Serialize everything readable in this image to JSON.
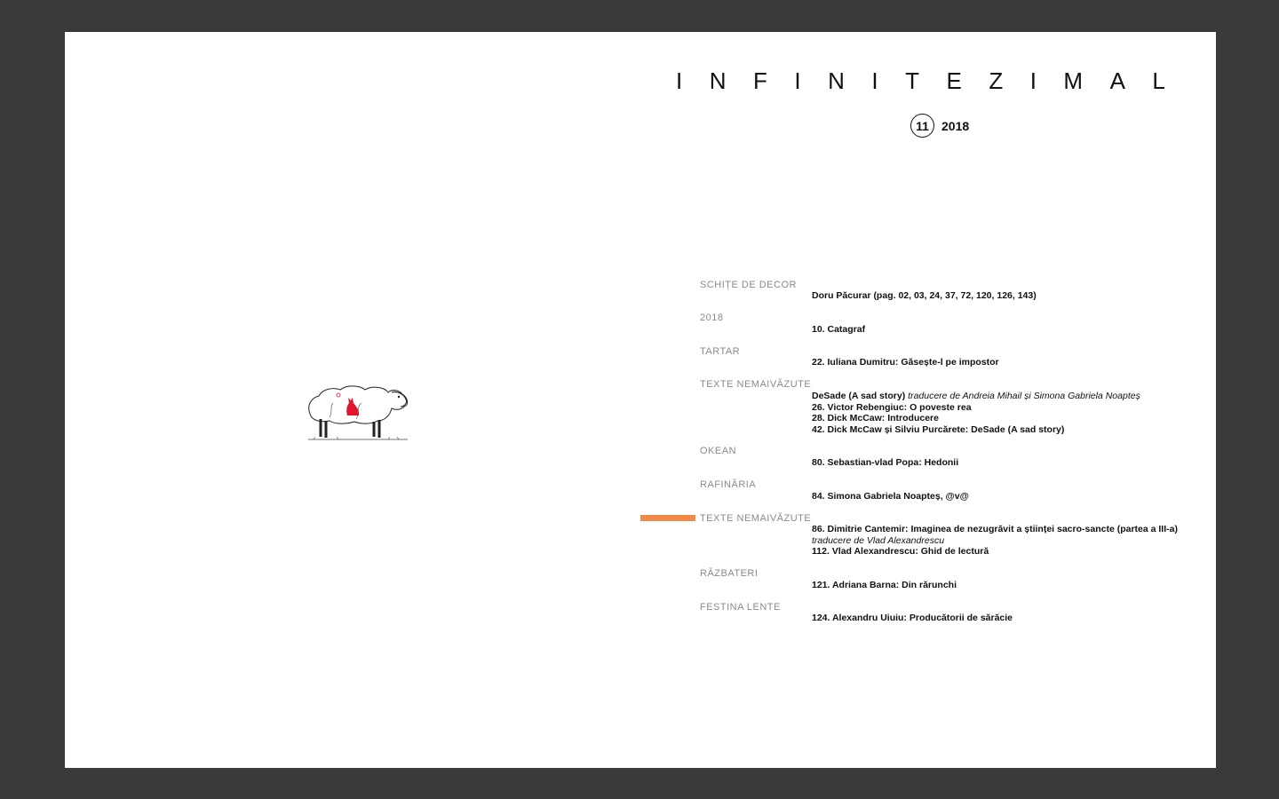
{
  "masthead": {
    "title": "INFINITEZIMAL",
    "issue_number": "11",
    "year": "2018"
  },
  "toc": [
    {
      "section": "SCHIȚE DE DECOR",
      "entries": [
        {
          "text": "Doru Păcurar (pag. 02, 03, 24, 37, 72, 120, 126, 143)"
        }
      ]
    },
    {
      "section": "2018",
      "entries": [
        {
          "text": "10. Catagraf"
        }
      ]
    },
    {
      "section": "TARTAR",
      "entries": [
        {
          "text": "22. Iuliana Dumitru: Găsește-l pe impostor"
        }
      ]
    },
    {
      "section": "TEXTE NEMAIVĂZUTE",
      "entries": [
        {
          "text": "DeSade (A sad story)",
          "italic": "traducere de Andreia Mihail și Simona Gabriela Noapteș"
        },
        {
          "text": "26. Victor Rebengiuc: O poveste rea"
        },
        {
          "text": "28. Dick McCaw: Introducere"
        },
        {
          "text": "42. Dick McCaw și Silviu Purcărete: DeSade (A sad story)"
        }
      ]
    },
    {
      "section": "OKEAN",
      "entries": [
        {
          "text": "80. Sebastian-vlad Popa: Hedonii"
        }
      ]
    },
    {
      "section": "RAFINĂRIA",
      "entries": [
        {
          "text": "84. Simona Gabriela Noapteș, @v@"
        }
      ]
    },
    {
      "section": "TEXTE NEMAIVĂZUTE",
      "entries": [
        {
          "text": "86. Dimitrie Cantemir: Imaginea de nezugrăvit a științei sacro-sancte (partea a III-a)"
        },
        {
          "italic": "traducere de Vlad Alexandrescu"
        },
        {
          "text": "112. Vlad Alexandrescu: Ghid de lectură"
        }
      ]
    },
    {
      "section": "RĂZBATERI",
      "entries": [
        {
          "text": "121. Adriana Barna: Din rărunchi"
        }
      ]
    },
    {
      "section": "FESTINA LENTE",
      "entries": [
        {
          "text": "124. Alexandru Uiuiu: Producătorii de sărăcie"
        }
      ]
    }
  ],
  "colors": {
    "marker": "#f08a46",
    "frame": "#3a3a3a",
    "wolf": "#e0182d"
  },
  "icons": {
    "illustration": "sheep-with-red-wolf-illustration"
  }
}
